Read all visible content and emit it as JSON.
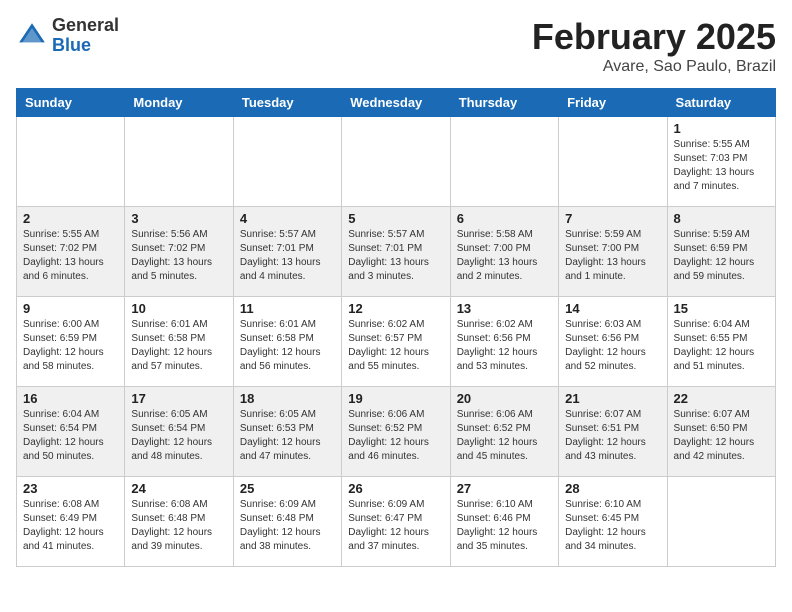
{
  "header": {
    "logo_line1": "General",
    "logo_line2": "Blue",
    "month": "February 2025",
    "location": "Avare, Sao Paulo, Brazil"
  },
  "days_of_week": [
    "Sunday",
    "Monday",
    "Tuesday",
    "Wednesday",
    "Thursday",
    "Friday",
    "Saturday"
  ],
  "weeks": [
    [
      {
        "day": "",
        "info": ""
      },
      {
        "day": "",
        "info": ""
      },
      {
        "day": "",
        "info": ""
      },
      {
        "day": "",
        "info": ""
      },
      {
        "day": "",
        "info": ""
      },
      {
        "day": "",
        "info": ""
      },
      {
        "day": "1",
        "info": "Sunrise: 5:55 AM\nSunset: 7:03 PM\nDaylight: 13 hours\nand 7 minutes."
      }
    ],
    [
      {
        "day": "2",
        "info": "Sunrise: 5:55 AM\nSunset: 7:02 PM\nDaylight: 13 hours\nand 6 minutes."
      },
      {
        "day": "3",
        "info": "Sunrise: 5:56 AM\nSunset: 7:02 PM\nDaylight: 13 hours\nand 5 minutes."
      },
      {
        "day": "4",
        "info": "Sunrise: 5:57 AM\nSunset: 7:01 PM\nDaylight: 13 hours\nand 4 minutes."
      },
      {
        "day": "5",
        "info": "Sunrise: 5:57 AM\nSunset: 7:01 PM\nDaylight: 13 hours\nand 3 minutes."
      },
      {
        "day": "6",
        "info": "Sunrise: 5:58 AM\nSunset: 7:00 PM\nDaylight: 13 hours\nand 2 minutes."
      },
      {
        "day": "7",
        "info": "Sunrise: 5:59 AM\nSunset: 7:00 PM\nDaylight: 13 hours\nand 1 minute."
      },
      {
        "day": "8",
        "info": "Sunrise: 5:59 AM\nSunset: 6:59 PM\nDaylight: 12 hours\nand 59 minutes."
      }
    ],
    [
      {
        "day": "9",
        "info": "Sunrise: 6:00 AM\nSunset: 6:59 PM\nDaylight: 12 hours\nand 58 minutes."
      },
      {
        "day": "10",
        "info": "Sunrise: 6:01 AM\nSunset: 6:58 PM\nDaylight: 12 hours\nand 57 minutes."
      },
      {
        "day": "11",
        "info": "Sunrise: 6:01 AM\nSunset: 6:58 PM\nDaylight: 12 hours\nand 56 minutes."
      },
      {
        "day": "12",
        "info": "Sunrise: 6:02 AM\nSunset: 6:57 PM\nDaylight: 12 hours\nand 55 minutes."
      },
      {
        "day": "13",
        "info": "Sunrise: 6:02 AM\nSunset: 6:56 PM\nDaylight: 12 hours\nand 53 minutes."
      },
      {
        "day": "14",
        "info": "Sunrise: 6:03 AM\nSunset: 6:56 PM\nDaylight: 12 hours\nand 52 minutes."
      },
      {
        "day": "15",
        "info": "Sunrise: 6:04 AM\nSunset: 6:55 PM\nDaylight: 12 hours\nand 51 minutes."
      }
    ],
    [
      {
        "day": "16",
        "info": "Sunrise: 6:04 AM\nSunset: 6:54 PM\nDaylight: 12 hours\nand 50 minutes."
      },
      {
        "day": "17",
        "info": "Sunrise: 6:05 AM\nSunset: 6:54 PM\nDaylight: 12 hours\nand 48 minutes."
      },
      {
        "day": "18",
        "info": "Sunrise: 6:05 AM\nSunset: 6:53 PM\nDaylight: 12 hours\nand 47 minutes."
      },
      {
        "day": "19",
        "info": "Sunrise: 6:06 AM\nSunset: 6:52 PM\nDaylight: 12 hours\nand 46 minutes."
      },
      {
        "day": "20",
        "info": "Sunrise: 6:06 AM\nSunset: 6:52 PM\nDaylight: 12 hours\nand 45 minutes."
      },
      {
        "day": "21",
        "info": "Sunrise: 6:07 AM\nSunset: 6:51 PM\nDaylight: 12 hours\nand 43 minutes."
      },
      {
        "day": "22",
        "info": "Sunrise: 6:07 AM\nSunset: 6:50 PM\nDaylight: 12 hours\nand 42 minutes."
      }
    ],
    [
      {
        "day": "23",
        "info": "Sunrise: 6:08 AM\nSunset: 6:49 PM\nDaylight: 12 hours\nand 41 minutes."
      },
      {
        "day": "24",
        "info": "Sunrise: 6:08 AM\nSunset: 6:48 PM\nDaylight: 12 hours\nand 39 minutes."
      },
      {
        "day": "25",
        "info": "Sunrise: 6:09 AM\nSunset: 6:48 PM\nDaylight: 12 hours\nand 38 minutes."
      },
      {
        "day": "26",
        "info": "Sunrise: 6:09 AM\nSunset: 6:47 PM\nDaylight: 12 hours\nand 37 minutes."
      },
      {
        "day": "27",
        "info": "Sunrise: 6:10 AM\nSunset: 6:46 PM\nDaylight: 12 hours\nand 35 minutes."
      },
      {
        "day": "28",
        "info": "Sunrise: 6:10 AM\nSunset: 6:45 PM\nDaylight: 12 hours\nand 34 minutes."
      },
      {
        "day": "",
        "info": ""
      }
    ]
  ]
}
